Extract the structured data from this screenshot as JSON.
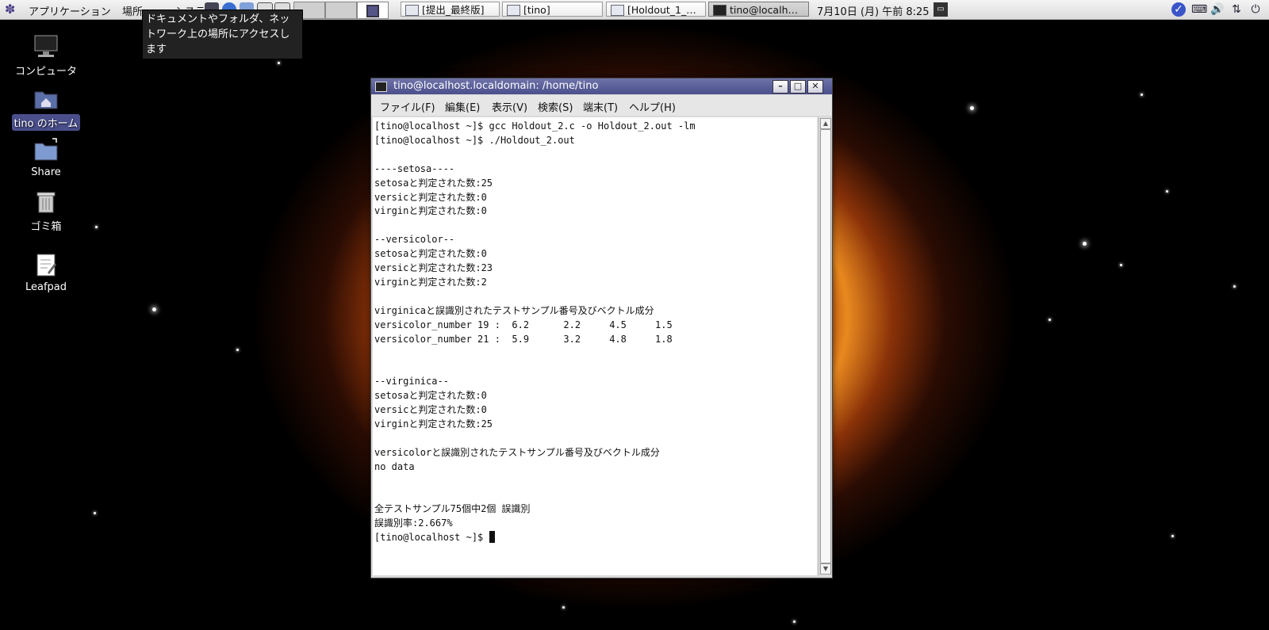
{
  "panel": {
    "menus": [
      "アプリケーション",
      "場所",
      "システム"
    ],
    "tasks": [
      "[提出_最終版]",
      "[tino]",
      "[Holdout_1_…",
      "tino@localh…"
    ],
    "clock": "7月10日 (月) 午前 8:25"
  },
  "tooltip": "ドキュメントやフォルダ、ネットワーク上の場所にアクセスします",
  "desktop": {
    "icons": [
      "コンピュータ",
      "tino のホーム",
      "Share",
      "ゴミ箱",
      "Leafpad"
    ]
  },
  "window": {
    "title": "tino@localhost.localdomain: /home/tino",
    "menus": [
      "ファイル(F)",
      "編集(E)",
      "表示(V)",
      "検索(S)",
      "端末(T)",
      "ヘルプ(H)"
    ]
  },
  "terminal": {
    "lines": [
      "[tino@localhost ~]$ gcc Holdout_2.c -o Holdout_2.out -lm",
      "[tino@localhost ~]$ ./Holdout_2.out",
      "",
      "----setosa----",
      "setosaと判定された数:25",
      "versicと判定された数:0",
      "virginと判定された数:0",
      "",
      "--versicolor--",
      "setosaと判定された数:0",
      "versicと判定された数:23",
      "virginと判定された数:2",
      "",
      "virginicaと誤識別されたテストサンプル番号及びベクトル成分",
      "versicolor_number 19 :  6.2      2.2     4.5     1.5",
      "versicolor_number 21 :  5.9      3.2     4.8     1.8",
      "",
      "",
      "--virginica--",
      "setosaと判定された数:0",
      "versicと判定された数:0",
      "virginと判定された数:25",
      "",
      "versicolorと誤識別されたテストサンプル番号及びベクトル成分",
      "no data",
      "",
      "",
      "全テストサンプル75個中2個 誤識別",
      "誤識別率:2.667%",
      "[tino@localhost ~]$ "
    ]
  }
}
